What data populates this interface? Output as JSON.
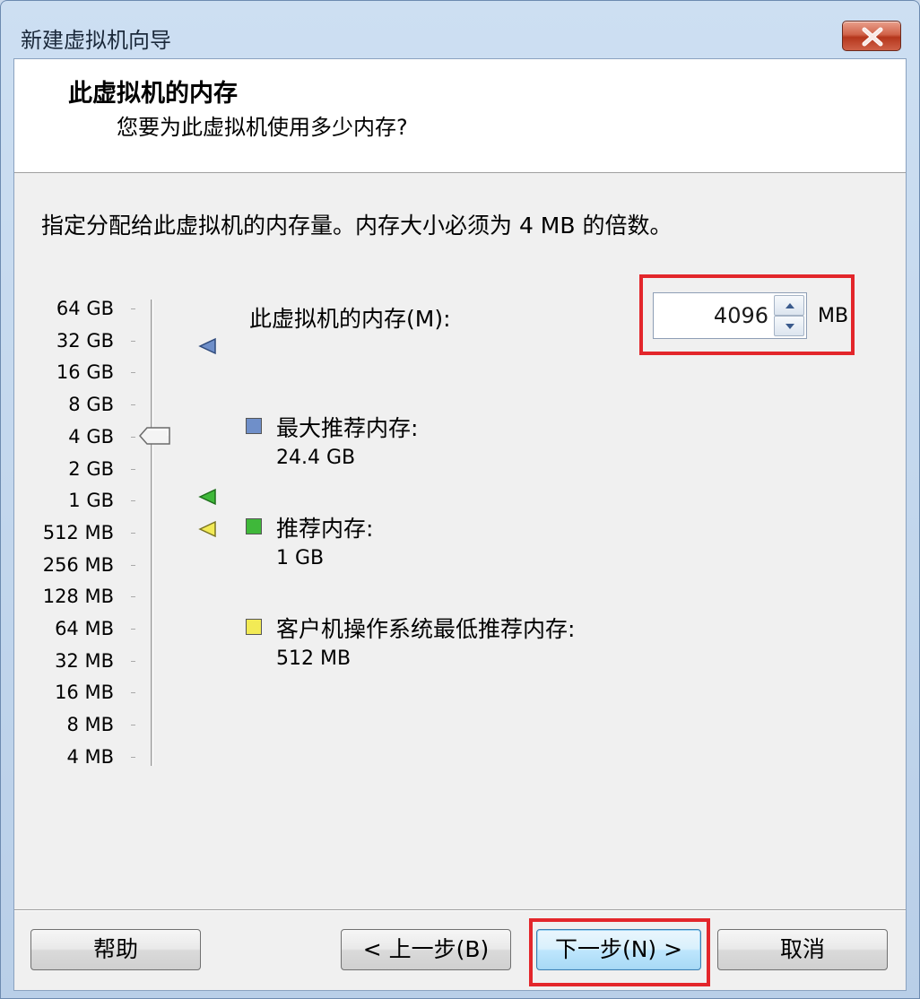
{
  "window": {
    "title": "新建虚拟机向导"
  },
  "header": {
    "title": "此虚拟机的内存",
    "subtitle": "您要为此虚拟机使用多少内存?"
  },
  "instruction": "指定分配给此虚拟机的内存量。内存大小必须为 4 MB 的倍数。",
  "scale": {
    "labels": [
      "64 GB",
      "32 GB",
      "16 GB",
      "8 GB",
      "4 GB",
      "2 GB",
      "1 GB",
      "512 MB",
      "256 MB",
      "128 MB",
      "64 MB",
      "32 MB",
      "16 MB",
      "8 MB",
      "4 MB"
    ],
    "selected_value": "4 GB"
  },
  "memory": {
    "label": "此虚拟机的内存(M):",
    "value": "4096",
    "unit": "MB"
  },
  "legend": {
    "max_recommended": {
      "title": "最大推荐内存:",
      "value": "24.4 GB",
      "color": "#6f8fc9"
    },
    "recommended": {
      "title": "推荐内存:",
      "value": "1 GB",
      "color": "#3fb83a"
    },
    "guest_min": {
      "title": "客户机操作系统最低推荐内存:",
      "value": "512 MB",
      "color": "#f2ea55"
    }
  },
  "buttons": {
    "help": "帮助",
    "back": "< 上一步(B)",
    "next": "下一步(N) >",
    "cancel": "取消"
  },
  "highlight_color": "#e3262b"
}
